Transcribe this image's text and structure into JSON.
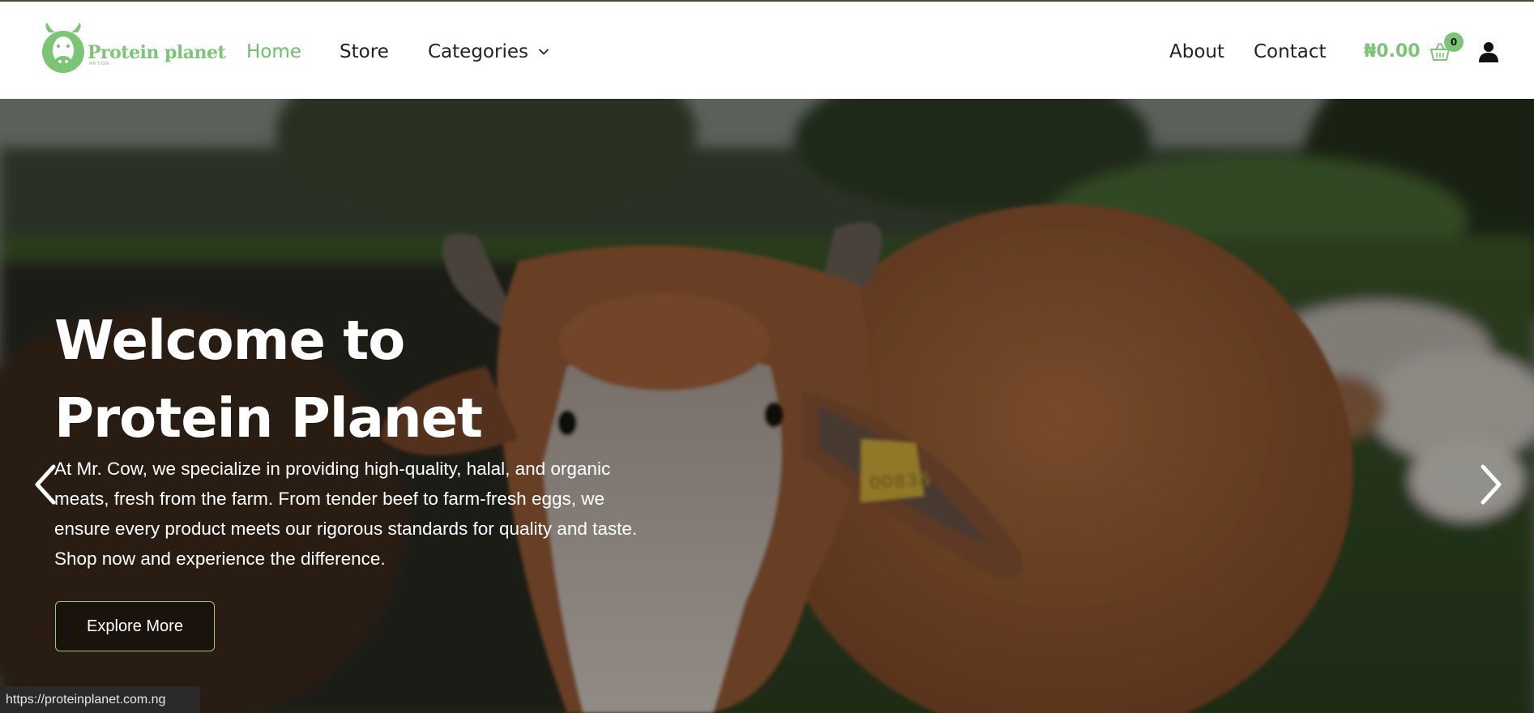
{
  "brand": {
    "name": "Protein planet",
    "sub": "MR COW",
    "accent_color": "#7cc576"
  },
  "nav": {
    "home": "Home",
    "store": "Store",
    "categories": "Categories",
    "about": "About",
    "contact": "Contact"
  },
  "cart": {
    "total": "₦0.00",
    "count": "0",
    "icon": "basket-icon"
  },
  "account": {
    "icon": "user-icon"
  },
  "hero": {
    "title_line1": "Welcome to",
    "title_line2": "Protein Planet",
    "description": "At Mr. Cow, we specialize in providing high-quality, halal, and organic meats, fresh from the farm. From tender beef to farm-fresh eggs, we ensure every product meets our rigorous standards for quality and taste. Shop now and experience the difference.",
    "button_label": "Explore More",
    "ear_tag": "00835",
    "prev_icon": "chevron-left-icon",
    "next_icon": "chevron-right-icon"
  },
  "status_bar": {
    "url": "https://proteinplanet.com.ng"
  }
}
